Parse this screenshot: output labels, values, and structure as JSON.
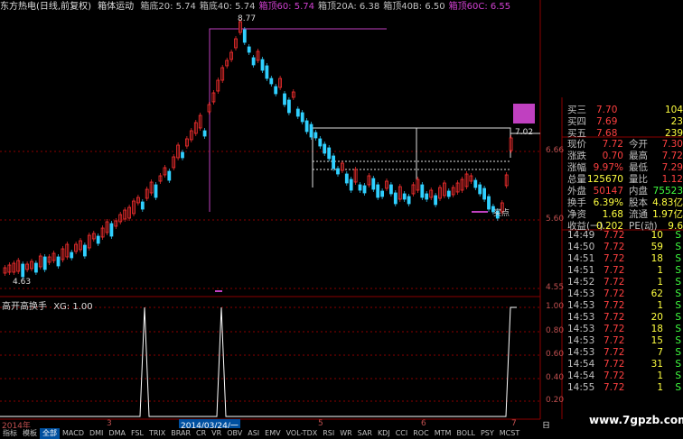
{
  "titlebar": {
    "stock": "东方热电(日线,前复权)",
    "indicator": "箱体运动",
    "items": [
      {
        "text": "箱底20: 5.74",
        "color": "#c0c0c0"
      },
      {
        "text": "箱底40: 5.74",
        "color": "#c0c0c0"
      },
      {
        "text": "箱顶60: 5.74",
        "color": "#d040d0"
      },
      {
        "text": "箱顶20A: 6.38",
        "color": "#c0c0c0"
      },
      {
        "text": "箱顶40B: 6.50",
        "color": "#c0c0c0"
      },
      {
        "text": "箱顶60C: 6.55",
        "color": "#d040d0"
      }
    ]
  },
  "main_chart": {
    "price_labels": [
      "6.66",
      "5.60",
      "4.55"
    ],
    "annotations": {
      "high": "8.77",
      "low": "4.63",
      "box_top": "7.02",
      "buy_point": "买点"
    }
  },
  "sub_chart": {
    "title": "高开高换手",
    "value_label": "XG: 1.00",
    "y_labels": [
      "1.00",
      "0.80",
      "0.60",
      "0.40",
      "0.20"
    ]
  },
  "quote_panel": {
    "asks": [
      {
        "label": "买三",
        "price": "7.70",
        "vol": "104"
      },
      {
        "label": "买四",
        "price": "7.69",
        "vol": "23"
      },
      {
        "label": "买五",
        "price": "7.68",
        "vol": "239"
      }
    ],
    "stats": [
      {
        "l1": "现价",
        "v1": "7.72",
        "l2": "今开",
        "v2": "7.30",
        "c1": "#ff4040",
        "c2": "#ff4040"
      },
      {
        "l1": "涨跌",
        "v1": "0.70",
        "l2": "最高",
        "v2": "7.72",
        "c1": "#ff4040",
        "c2": "#ff4040"
      },
      {
        "l1": "涨幅",
        "v1": "9.97%",
        "l2": "最低",
        "v2": "7.29",
        "c1": "#ff4040",
        "c2": "#ff4040"
      },
      {
        "l1": "总量",
        "v1": "125670",
        "l2": "量比",
        "v2": "1.12",
        "c1": "#ffff40",
        "c2": "#ff4040"
      },
      {
        "l1": "外盘",
        "v1": "50147",
        "l2": "内盘",
        "v2": "75523",
        "c1": "#ff4040",
        "c2": "#40ff40"
      },
      {
        "l1": "换手",
        "v1": "6.39%",
        "l2": "股本",
        "v2": "4.83亿",
        "c1": "#ffff40",
        "c2": "#ffff40"
      },
      {
        "l1": "净资",
        "v1": "1.68",
        "l2": "流通",
        "v2": "1.97亿",
        "c1": "#ffff40",
        "c2": "#ffff40"
      },
      {
        "l1": "收益(一)",
        "v1": "0.202",
        "l2": "PE(动)",
        "v2": "9.6",
        "c1": "#ffff40",
        "c2": "#ffff40"
      }
    ],
    "ticks": [
      {
        "time": "14:49",
        "price": "7.72",
        "vol": "10",
        "flag": "S"
      },
      {
        "time": "14:50",
        "price": "7.72",
        "vol": "59",
        "flag": "S"
      },
      {
        "time": "14:51",
        "price": "7.72",
        "vol": "18",
        "flag": "S"
      },
      {
        "time": "14:51",
        "price": "7.72",
        "vol": "1",
        "flag": "S"
      },
      {
        "time": "14:52",
        "price": "7.72",
        "vol": "1",
        "flag": "S"
      },
      {
        "time": "14:53",
        "price": "7.72",
        "vol": "62",
        "flag": "S"
      },
      {
        "time": "14:53",
        "price": "7.72",
        "vol": "1",
        "flag": "S"
      },
      {
        "time": "14:53",
        "price": "7.72",
        "vol": "20",
        "flag": "S"
      },
      {
        "time": "14:53",
        "price": "7.72",
        "vol": "18",
        "flag": "S"
      },
      {
        "time": "14:53",
        "price": "7.72",
        "vol": "15",
        "flag": "S"
      },
      {
        "time": "14:53",
        "price": "7.72",
        "vol": "7",
        "flag": "S"
      },
      {
        "time": "14:54",
        "price": "7.72",
        "vol": "31",
        "flag": "S"
      },
      {
        "time": "14:54",
        "price": "7.72",
        "vol": "1",
        "flag": "S"
      },
      {
        "time": "14:55",
        "price": "7.72",
        "vol": "1",
        "flag": "S"
      }
    ]
  },
  "date_axis": {
    "labels": [
      "2014年",
      "3",
      "2014/03/24/一",
      "5",
      "6",
      "7"
    ],
    "right_label": "日"
  },
  "tabs": [
    "指标",
    "模板",
    "全部",
    "MACD",
    "DMI",
    "DMA",
    "FSL",
    "TRIX",
    "BRAR",
    "CR",
    "VR",
    "OBV",
    "ASI",
    "EMV",
    "VOL-TDX",
    "RSI",
    "WR",
    "SAR",
    "KDJ",
    "CCI",
    "ROC",
    "MTM",
    "BOLL",
    "PSY",
    "MCST"
  ],
  "active_tab": "全部",
  "watermark": "www.7gpzb.com",
  "colors": {
    "up": "#ff3030",
    "down": "#30d0ff",
    "box": "#c040c0",
    "grid": "#8b0000",
    "text": "#c0c0c0"
  }
}
